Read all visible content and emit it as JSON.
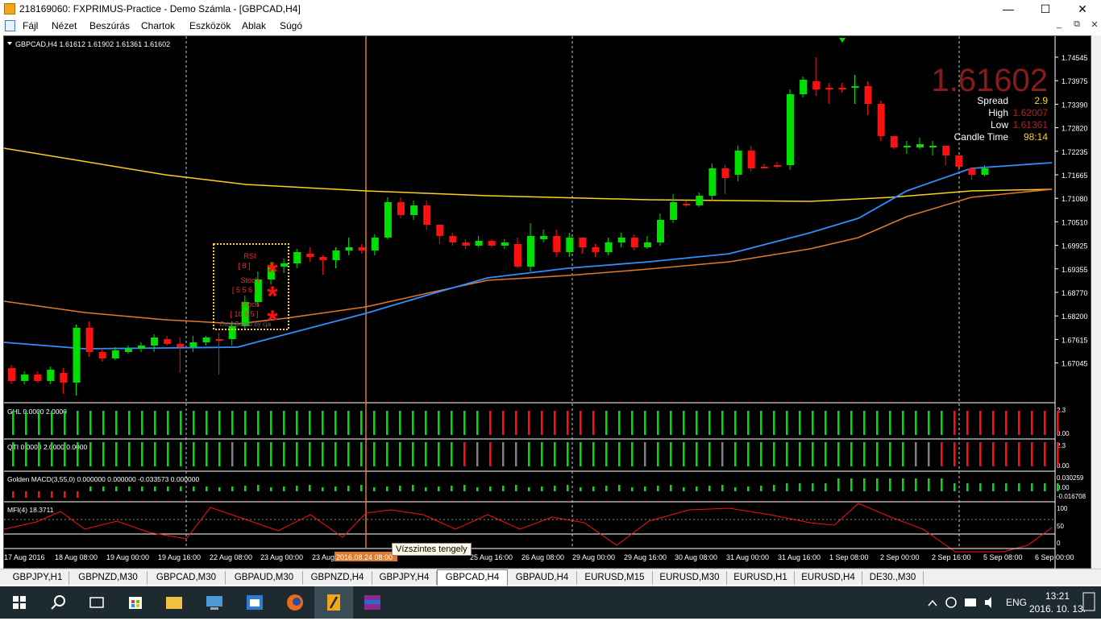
{
  "window": {
    "title": "218169060: FXPRIMUS-Practice - Demo Számla - [GBPCAD,H4]"
  },
  "window_controls": {
    "minimize": "—",
    "maximize": "☐",
    "close": "✕"
  },
  "menu": {
    "items": [
      "Fájl",
      "Nézet",
      "Beszúrás",
      "Chartok",
      "Eszközök",
      "Ablak",
      "Súgó"
    ]
  },
  "mdi_controls": {
    "minimize": "_",
    "restore": "⧉",
    "close": "✕"
  },
  "chart": {
    "header": "GBPCAD,H4  1.61612 1.61902 1.61361 1.61602",
    "big_price": "1.61602",
    "info": [
      {
        "label": "Spread",
        "value": "2.9",
        "color": "#ffd11a"
      },
      {
        "label": "High",
        "value": "1.62007",
        "color": "#b22222"
      },
      {
        "label": "Low",
        "value": "1.61361",
        "color": "#b22222"
      },
      {
        "label": "Candle Time",
        "value": "98:14",
        "color": "#ffd11a"
      }
    ],
    "price_axis": [
      "1.74545",
      "1.73975",
      "1.73390",
      "1.72820",
      "1.72235",
      "1.71665",
      "1.71080",
      "1.70510",
      "1.69925",
      "1.69355",
      "1.68770",
      "1.68200",
      "1.67615",
      "1.67045"
    ],
    "dashboard": {
      "rows": [
        {
          "label": "RSI",
          "params": "[ 8 ]"
        },
        {
          "label": "Stoch",
          "params": "[ 5 5 6 ]"
        },
        {
          "label": "Stoch",
          "params": "[ 10 5 5 ]"
        }
      ],
      "footer": "DashBoard by cja",
      "mark": "*"
    },
    "panels": [
      {
        "label": "GHL 0.0000 2.0000",
        "axis_top": "2.3",
        "axis_bottom": "0.00"
      },
      {
        "label": "QTI 0.0000 2.0000 0.0000",
        "axis_top": "2.3",
        "axis_bottom": "0.00"
      },
      {
        "label": "Golden MACD(3,55,0) 0.000000 0.000000 -0.033573 0.000000",
        "axis_top": "0.030259",
        "axis_mid": "0.00",
        "axis_bottom": "-0.016708"
      },
      {
        "label": "MFI(4) 18.3711",
        "axis_top": "100",
        "axis_mid": "50",
        "axis_bottom": "0"
      }
    ],
    "time_axis": [
      "17 Aug 2016",
      "18 Aug 08:00",
      "19 Aug 00:00",
      "19 Aug 16:00",
      "22 Aug 08:00",
      "23 Aug 00:00",
      "23 Aug",
      "2016.08.24 08:00",
      "25 Aug 16:00",
      "26 Aug 08:00",
      "29 Aug 00:00",
      "29 Aug 16:00",
      "30 Aug 08:00",
      "31 Aug 00:00",
      "31 Aug 16:00",
      "1 Sep 08:00",
      "2 Sep 00:00",
      "2 Sep 16:00",
      "5 Sep 08:00",
      "6 Sep 00:00"
    ],
    "tooltip": "Vízszintes tengely",
    "colors": {
      "bull": "#00e000",
      "bear": "#ff1010",
      "gray": "#808080",
      "ma_blue": "#2f8fff",
      "ma_orange": "#e07a2a",
      "ma_yellow": "#ffd11a",
      "vline": "#e07a2a"
    }
  },
  "tabs": [
    {
      "label": "GBPJPY,H1"
    },
    {
      "label": "GBPNZD,M30"
    },
    {
      "label": "GBPCAD,M30"
    },
    {
      "label": "GBPAUD,M30"
    },
    {
      "label": "GBPNZD,H4"
    },
    {
      "label": "GBPJPY,H4"
    },
    {
      "label": "GBPCAD,H4",
      "active": true
    },
    {
      "label": "GBPAUD,H4"
    },
    {
      "label": "EURUSD,M15"
    },
    {
      "label": "EURUSD,M30"
    },
    {
      "label": "EURUSD,H1"
    },
    {
      "label": "EURUSD,H4"
    },
    {
      "label": "DE30.,M30"
    }
  ],
  "taskbar": {
    "icons": [
      "start-icon",
      "search-icon",
      "task-view-icon",
      "store-icon",
      "file-explorer-icon",
      "computer-icon",
      "outlook-icon",
      "firefox-icon",
      "metatrader-icon",
      "winrar-icon"
    ],
    "tray": {
      "language": "ENG",
      "time": "13:21",
      "date": "2016. 10. 13."
    }
  }
}
